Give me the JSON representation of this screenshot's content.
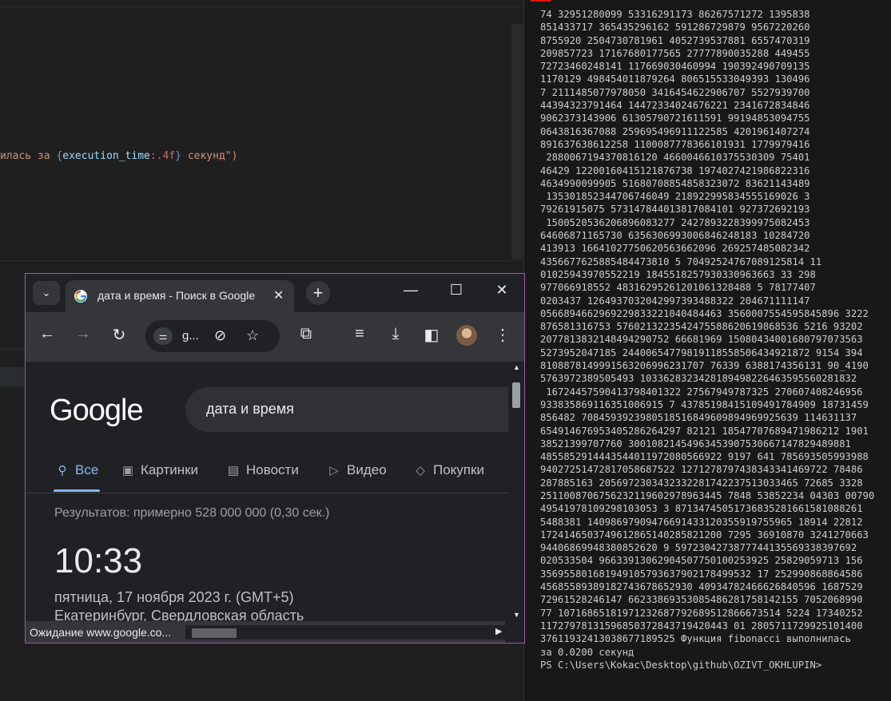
{
  "editor": {
    "code_prefix": "илась за ",
    "code_open": "{",
    "code_var": "execution_time",
    "code_fmt": ":.4f",
    "code_close": "}",
    "code_suffix": " секунд\")"
  },
  "terminal": {
    "lines": [
      "74 32951280099 53316291173 86267571272 1395838",
      "851433717 365435296162 591286729879 9567220260",
      "8755920 2504730781961 4052739537881 6557470319",
      "209857723 17167680177565 27777890035288 449455",
      "72723460248141 117669030460994 190392490709135",
      "1170129 498454011879264 806515533049393 130496",
      "7 2111485077978050 3416454622906707 5527939700",
      "44394323791464 14472334024676221 2341672834846",
      "9062373143906 61305790721611591 99194853094755",
      "0643816367088 259695496911122585 4201961407274",
      "891637638612258 1100087778366101931 1779979416",
      " 2880067194370816120 4660046610375530309 75401",
      "46429 12200160415121876738 1974027421986822316",
      "4634990099905 51680708854858323072 83621143489",
      " 135301852344706746049 218922995834555169026 3",
      "79261915075 573147844013817084101 927372692193",
      " 1500520536206896083277 2427893228399975082453",
      "64606871165730 6356306993006846248183 10284720",
      "413913 16641027750620563662096 269257485082342",
      "4356677625885484473810 5 70492524767089125814 11",
      "01025943970552219 1845518257930330963663 33 298",
      "977066918552 48316295261201061328488 5 78177407",
      "0203437 1264937032042997393488322 204671111147",
      "0566894662969229833221040484463 3560007554595845896 3222",
      "876581316753 5760213223542475588620619868536 5216 93202",
      "2077813832148494290752 66681969 15080434001680797073563",
      "5273952047185 24400654779819118558506434921872 9154 394",
      "8108878149991563206996231707 76339 6388174356131 90_4190",
      "5763972389505493 1033628323428189498226463595560281832",
      " 16724457590413798401322 27567949787325 270607408246956",
      "933835869116351006915 7 43785198415109491784909 18731459",
      "856482 7084593923980518516849609894969925639 114631137",
      "654914676953405286264297 82121 18547707689471986212 1901",
      "38521399707760 30010821454963453907530667147829489881",
      "4855852914443544011972080566922 9197 641 785693505993988",
      "94027251472817058687522 1271278797438343341469722 78486",
      "287885163 2056972303432332281742237513033465 72685 3328",
      "2511008706756232119602978963445 7848 53852234 04303 00790",
      "49541978109298103053 3 87134745051736835281661581088261",
      "5488381 14098697909476691433120355919755965 18914 22812",
      "1724146503749612865140285821200 7295 36910870 3241270663",
      "94406869948380852620 9 5972304273877744135569338397692",
      "020533504 96633913062904507750100253925 25829059713 156",
      "356955801681949105793637902178499532 17 252990868864586",
      "45685589389182743678652930 40934782466626840596 1687529",
      "72961528246147 66233869353085486281758142155 7052068990",
      "77 10716865181971232687792689512866673514 5224 17340252",
      "11727978131596850372843719420443 01 2805711729925101400",
      "37611932413038677189525 Функция fibonacci выполнилась",
      "за 0.0200 секунд",
      "PS C:\\Users\\Kokac\\Desktop\\github\\OZIVT_OKHLUPIN>"
    ]
  },
  "chrome": {
    "tab_title": "дата и время - Поиск в Google",
    "tab_close": "✕",
    "new_tab": "+",
    "minimize": "—",
    "maximize": "☐",
    "close": "✕",
    "omnibox_text": "g...",
    "search_query": "дата и время",
    "logo": "Google",
    "tabs": [
      "Все",
      "Картинки",
      "Новости",
      "Видео",
      "Покупки"
    ],
    "results_count": "Результатов: примерно 528 000 000 (0,30 сек.)",
    "time": "10:33",
    "date": "пятница, 17 ноября 2023 г. (GMT+5)",
    "place": "Екатеринбург, Свердловская область",
    "status": "Ожидание www.google.co..."
  },
  "colors": {
    "google_blue": "#4285f4",
    "google_red": "#ea4335",
    "google_yellow": "#fbbc05",
    "google_green": "#34a853",
    "active_tab": "#8ab4f8",
    "window_border": "#9b59b6"
  }
}
